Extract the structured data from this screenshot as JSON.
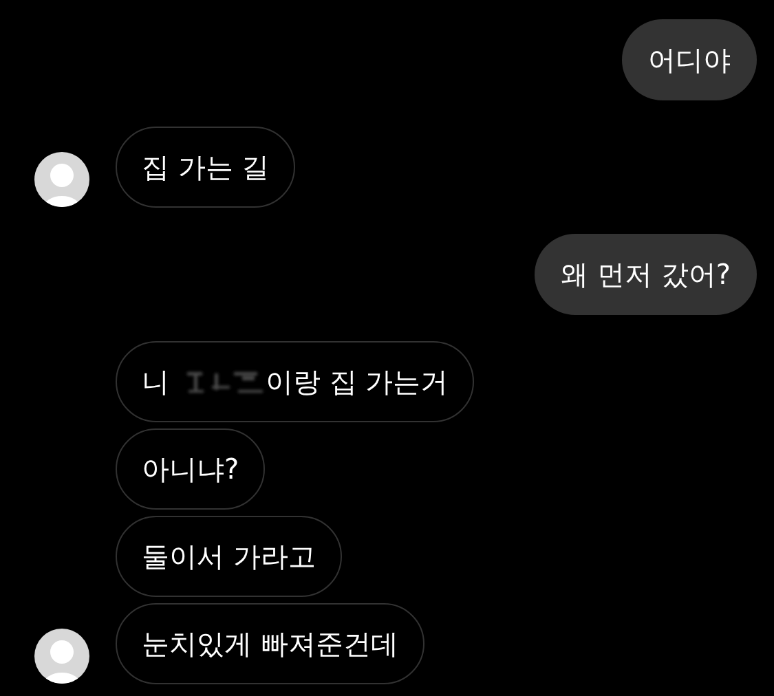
{
  "messages": [
    {
      "kind": "sent",
      "bubbles": [
        {
          "segments": [
            {
              "kind": "text",
              "text": "어디야"
            }
          ]
        }
      ]
    },
    {
      "kind": "received",
      "bubbles": [
        {
          "segments": [
            {
              "kind": "text",
              "text": "집 가는 길"
            }
          ]
        }
      ]
    },
    {
      "kind": "sent",
      "bubbles": [
        {
          "segments": [
            {
              "kind": "text",
              "text": "왜 먼저 갔어?"
            }
          ]
        }
      ]
    },
    {
      "kind": "received",
      "bubbles": [
        {
          "segments": [
            {
              "kind": "text",
              "text": "니"
            },
            {
              "kind": "redaction"
            },
            {
              "kind": "text",
              "text": "이랑 집 가는거"
            }
          ]
        },
        {
          "segments": [
            {
              "kind": "text",
              "text": "아니냐?"
            }
          ]
        },
        {
          "segments": [
            {
              "kind": "text",
              "text": "둘이서 가라고"
            }
          ]
        },
        {
          "segments": [
            {
              "kind": "text",
              "text": "눈치있게 빠져준건데"
            }
          ]
        }
      ]
    }
  ]
}
